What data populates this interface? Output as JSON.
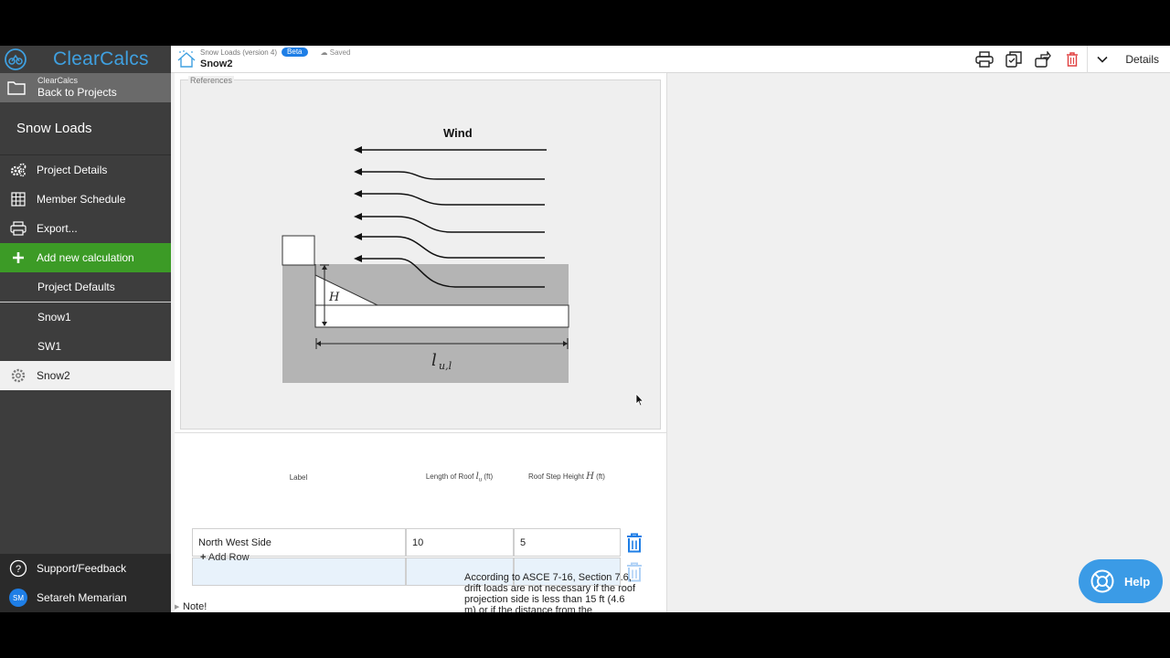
{
  "brand": {
    "name": "ClearCalcs"
  },
  "back": {
    "small": "ClearCalcs",
    "label": "Back to Projects"
  },
  "project": {
    "title": "Snow Loads"
  },
  "nav": {
    "project_details": "Project Details",
    "member_schedule": "Member Schedule",
    "export": "Export...",
    "add_new": "Add new calculation",
    "project_defaults": "Project Defaults",
    "calcs": [
      "Snow1",
      "SW1",
      "Snow2"
    ],
    "support": "Support/Feedback",
    "user_initials": "SM",
    "user_name": "Setareh Memarian"
  },
  "header": {
    "calc_type": "Snow Loads (version 4)",
    "beta": "Beta",
    "saved": "Saved",
    "title": "Snow2",
    "details": "Details"
  },
  "references": {
    "legend": "References",
    "diagram": {
      "wind_label": "Wind",
      "height_label": "H",
      "length_label": "l",
      "length_sub": "u,l"
    }
  },
  "table": {
    "headers": {
      "label": "Label",
      "length": "Length of Roof",
      "length_sym": "l",
      "length_sub": "u",
      "length_unit": "(ft)",
      "height": "Roof Step Height",
      "height_sym": "H",
      "height_unit": "(ft)"
    },
    "rows": [
      {
        "label": "North West Side",
        "length": "10",
        "height": "5"
      },
      {
        "label": "",
        "length": "",
        "height": ""
      }
    ],
    "add_row": "Add Row"
  },
  "note": {
    "label": "Note!",
    "text": "According to ASCE 7-16, Section 7.6, drift loads are not necessary if the roof projection side is less than 15 ft (4.6 m) or if the distance from the"
  },
  "help": {
    "label": "Help"
  },
  "colors": {
    "accent": "#3fa0e0",
    "add_green": "#3c9b26",
    "sidebar": "#3d3d3d",
    "trash_blue": "#1e7ee6"
  }
}
